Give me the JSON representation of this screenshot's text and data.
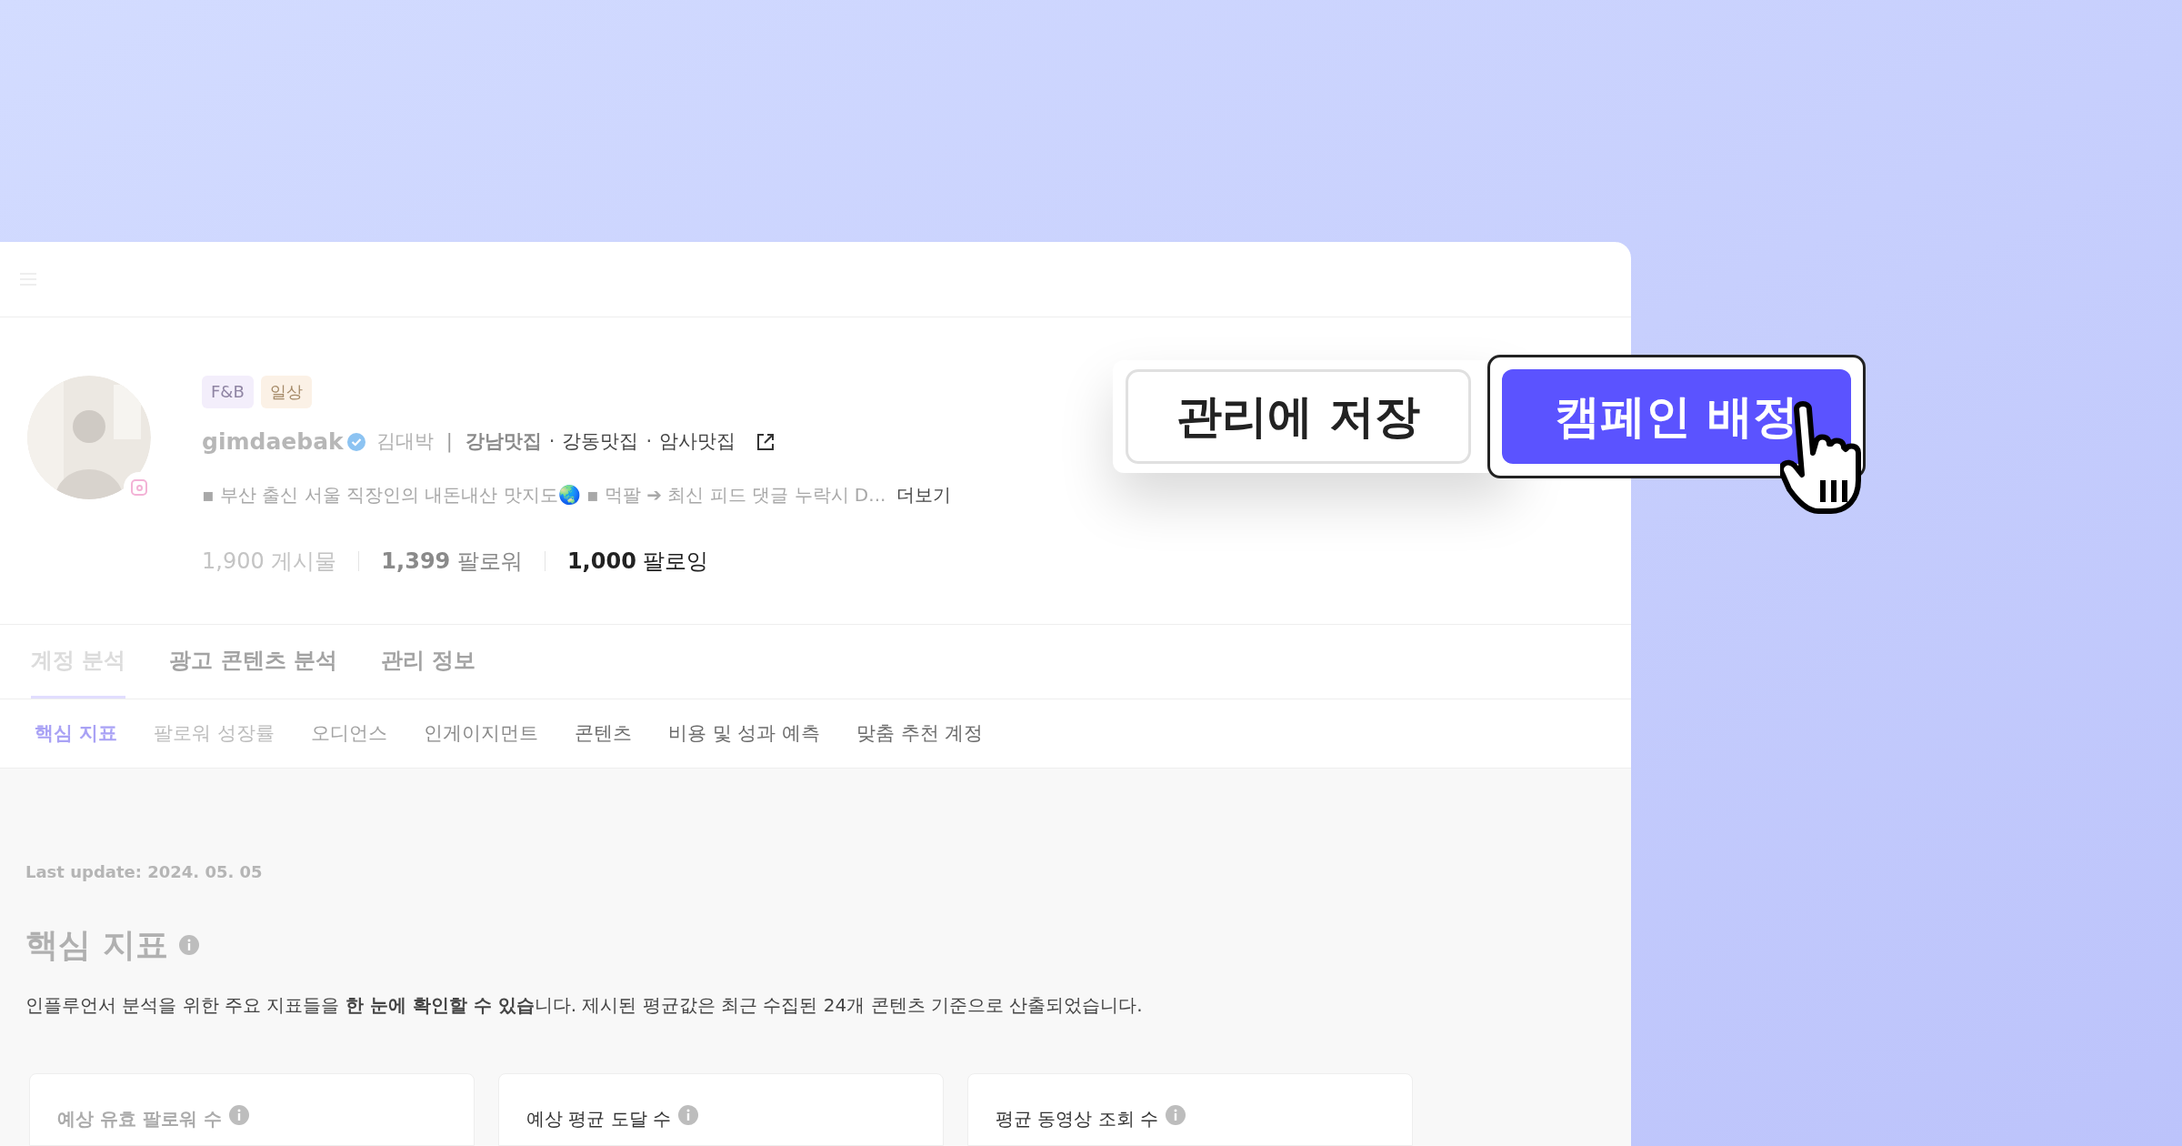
{
  "profile": {
    "tags": [
      {
        "label": "F&B",
        "color": "#f3eefb"
      },
      {
        "label": "일상",
        "color": "#fbf1e6"
      }
    ],
    "username": "gimdaebak",
    "verified": true,
    "name": "김대박",
    "separator": "|",
    "keywords": [
      "강남맛집",
      "강동맛집",
      "암사맛집"
    ],
    "keyword_separator": "·",
    "bio": "▪ 부산 출신 서울 직장인의 내돈내산 맛지도🌏 ▪ 먹팔 ➔ 최신 피드 댓글 누락시 D...",
    "more": "더보기",
    "stats": [
      {
        "value": "1,900",
        "label": "게시물"
      },
      {
        "value": "1,399",
        "label": "팔로워"
      },
      {
        "value": "1,000",
        "label": "팔로잉"
      }
    ]
  },
  "tabs": [
    {
      "label": "계정 분석",
      "selected": true
    },
    {
      "label": "광고 콘텐츠 분석",
      "selected": false
    },
    {
      "label": "관리 정보",
      "selected": false
    }
  ],
  "subtabs": [
    {
      "label": "핵심 지표",
      "selected": true
    },
    {
      "label": "팔로워 성장률",
      "selected": false
    },
    {
      "label": "오디언스",
      "selected": false
    },
    {
      "label": "인게이지먼트",
      "selected": false
    },
    {
      "label": "콘텐츠",
      "selected": false
    },
    {
      "label": "비용 및 성과 예측",
      "selected": false
    },
    {
      "label": "맞춤 추천 계정",
      "selected": false
    }
  ],
  "last_update": "Last update: 2024. 05. 05",
  "section": {
    "title": "핵심 지표",
    "description": "인플루언서 분석을 위한 주요 지표들을 **한 눈에 확인할 수 있습**니다. 제시된 평균값은 최근 수집된 24개 콘텐츠 기준으로 산출되었습니다."
  },
  "metric_cards": [
    {
      "label": "예상 유효 팔로워 수"
    },
    {
      "label": "예상 평균 도달 수"
    },
    {
      "label": "평균 동영상 조회 수"
    }
  ],
  "actions": [
    {
      "label": "관리에 저장",
      "kind": "secondary"
    },
    {
      "label": "캠페인 배정",
      "kind": "primary"
    }
  ]
}
